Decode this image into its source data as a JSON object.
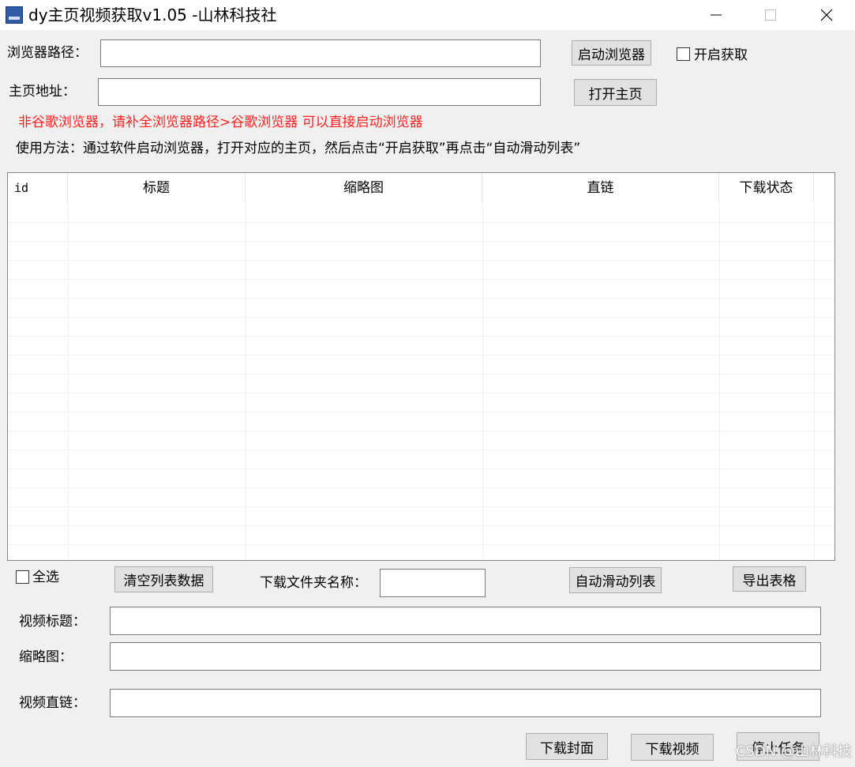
{
  "window": {
    "title": "dy主页视频获取v1.05 -山林科技社",
    "minimize": "minimize",
    "maximize": "maximize",
    "close": "close"
  },
  "top": {
    "browser_path_label": "浏览器路径：",
    "browser_path_value": "",
    "launch_browser_button": "启动浏览器",
    "enable_fetch_label": "开启获取",
    "enable_fetch_checked": false,
    "homepage_label": "主页地址：",
    "homepage_value": "",
    "open_homepage_button": "打开主页",
    "warning_text": "非谷歌浏览器，请补全浏览器路径>谷歌浏览器 可以直接启动浏览器",
    "usage_text": "使用方法：通过软件启动浏览器，打开对应的主页，然后点击“开启获取”再点击“自动滑动列表”"
  },
  "table": {
    "columns": [
      "id",
      "标题",
      "缩略图",
      "直链",
      "下载状态"
    ],
    "rows": []
  },
  "actions": {
    "select_all_label": "全选",
    "select_all_checked": false,
    "clear_list_button": "清空列表数据",
    "folder_name_label": "下载文件夹名称：",
    "folder_name_value": "",
    "auto_scroll_button": "自动滑动列表",
    "export_table_button": "导出表格"
  },
  "detail": {
    "video_title_label": "视频标题：",
    "video_title_value": "",
    "thumbnail_label": "缩略图：",
    "thumbnail_value": "",
    "direct_link_label": "视频直链：",
    "direct_link_value": ""
  },
  "bottom": {
    "download_cover_button": "下载封面",
    "download_video_button": "下载视频",
    "stop_task_button": "停止任务"
  },
  "watermark": "CSDN @山林科技"
}
